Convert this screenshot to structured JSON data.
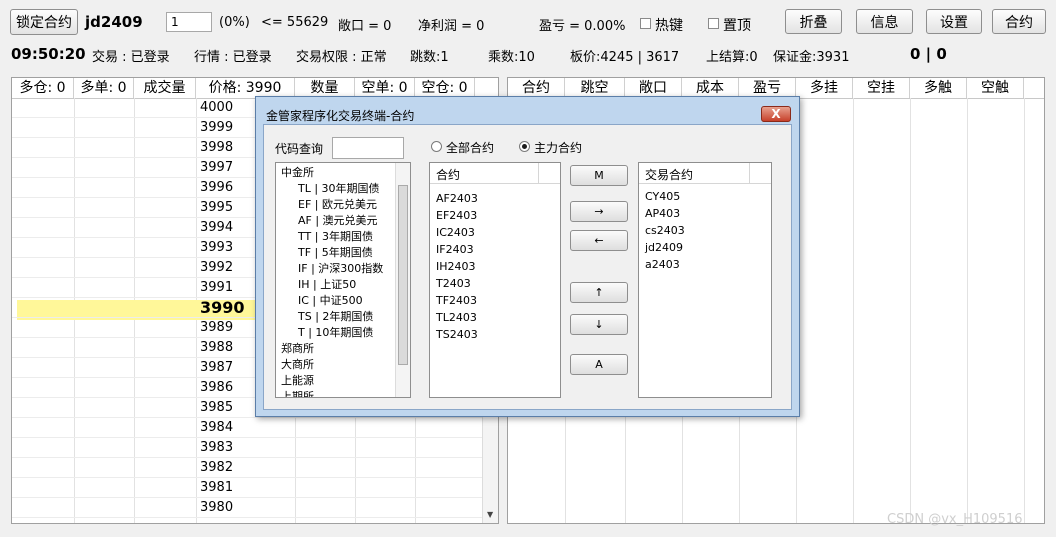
{
  "toolbar": {
    "lock_button": "锁定合约",
    "contract": "jd2409",
    "qty_value": "1",
    "pct": "(0%)",
    "limit": "<= 55629",
    "open_pos": "敞口 = 0",
    "net_profit": "净利润 = 0",
    "pnl": "盈亏 = 0.00%",
    "hotkey_label": "热键",
    "top_label": "置顶",
    "fold_button": "折叠",
    "info_button": "信息",
    "settings_button": "设置",
    "contract_button": "合约"
  },
  "status": {
    "time": "09:50:20",
    "trade": "交易 : 已登录",
    "quote": "行情 : 已登录",
    "rights": "交易权限 : 正常",
    "jumps": "跳数:1",
    "mult": "乘数:10",
    "board": "板价:4245 | 3617",
    "settle": "上结算:0",
    "margin": "保证金:3931",
    "score": "0 | 0"
  },
  "left_table": {
    "headers": [
      "多仓: 0",
      "多单: 0",
      "成交量",
      "价格: 3990",
      "数量",
      "空单: 0",
      "空仓: 0"
    ],
    "prices": [
      "4000",
      "3999",
      "3998",
      "3997",
      "3996",
      "3995",
      "3994",
      "3993",
      "3992",
      "3991",
      "3990",
      "3989",
      "3988",
      "3987",
      "3986",
      "3985",
      "3984",
      "3983",
      "3982",
      "3981",
      "3980"
    ],
    "highlight_price": "3990",
    "highlight_color": "#fff799"
  },
  "right_table": {
    "headers": [
      "合约",
      "跳空",
      "敞口",
      "成本",
      "盈亏",
      "多挂",
      "空挂",
      "多触",
      "空触"
    ]
  },
  "dialog": {
    "title": "金管家程序化交易终端-合约",
    "close": "X",
    "search_label": "代码查询",
    "search_value": "",
    "radio_all": "全部合约",
    "radio_main": "主力合约",
    "tree": {
      "root": "中金所",
      "children": [
        "TL | 30年期国债",
        "EF | 欧元兑美元",
        "AF | 澳元兑美元",
        "TT | 3年期国债",
        "TF | 5年期国债",
        "IF | 沪深300指数",
        "IH | 上证50",
        "IC | 中证500",
        "TS | 2年期国债",
        "T | 10年期国债"
      ],
      "others": [
        "郑商所",
        "大商所",
        "上能源",
        "上期所"
      ]
    },
    "contracts_header": "合约",
    "contracts": [
      "AF2403",
      "EF2403",
      "IC2403",
      "IF2403",
      "IH2403",
      "T2403",
      "TF2403",
      "TL2403",
      "TS2403"
    ],
    "buttons": {
      "m": "M",
      "right": "→",
      "left": "←",
      "up": "↑",
      "down": "↓",
      "a": "A"
    },
    "trade_header": "交易合约",
    "trade_contracts": [
      "CY405",
      "AP403",
      "cs2403",
      "jd2409",
      "a2403"
    ]
  },
  "watermark": "CSDN @vx_H109516"
}
